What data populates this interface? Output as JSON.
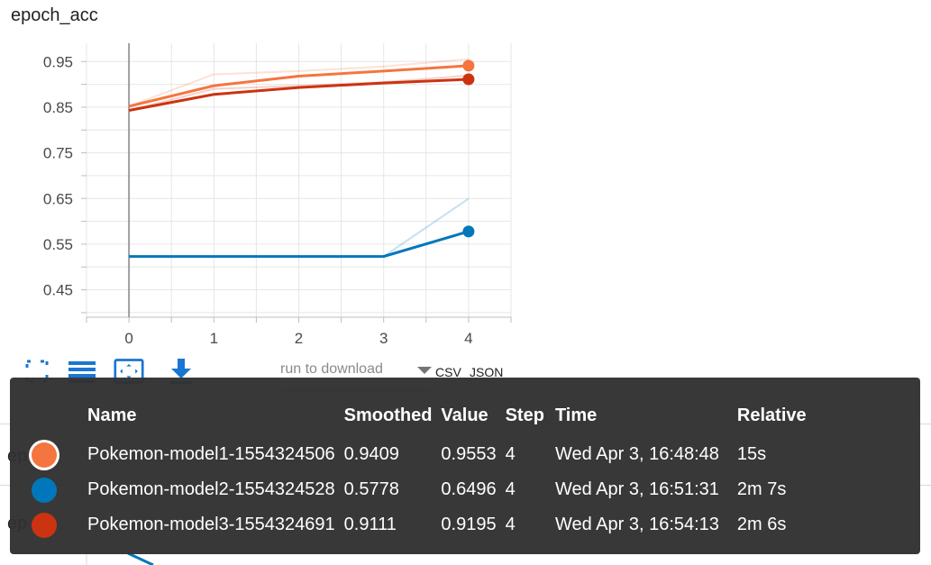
{
  "card": {
    "title": "epoch_acc"
  },
  "chart_data": {
    "type": "line",
    "x": [
      0,
      1,
      2,
      3,
      4
    ],
    "xticks": [
      "0",
      "1",
      "2",
      "3",
      "4"
    ],
    "yticks": [
      "0.45",
      "0.55",
      "0.65",
      "0.75",
      "0.85",
      "0.95"
    ],
    "xlim": [
      -0.5,
      4.5
    ],
    "ylim": [
      0.39,
      0.99
    ],
    "grid": true,
    "series": [
      {
        "name": "Pokemon-model1-1554324506",
        "color": "#f4753f",
        "values": [
          0.852,
          0.922,
          0.929,
          0.939,
          0.9553
        ],
        "smoothed": [
          0.852,
          0.897,
          0.918,
          0.929,
          0.9409
        ]
      },
      {
        "name": "Pokemon-model2-1554324528",
        "color": "#0077bb",
        "values": [
          0.523,
          0.523,
          0.523,
          0.523,
          0.6496
        ],
        "smoothed": [
          0.523,
          0.523,
          0.523,
          0.523,
          0.5778
        ]
      },
      {
        "name": "Pokemon-model3-1554324691",
        "color": "#cc3311",
        "values": [
          0.843,
          0.89,
          0.897,
          0.905,
          0.9195
        ],
        "smoothed": [
          0.843,
          0.878,
          0.893,
          0.903,
          0.9111
        ]
      }
    ]
  },
  "toolbar": {
    "fullscreen_icon": "fullscreen-icon",
    "lines_icon": "toggle-lines-icon",
    "fit_icon": "fit-domain-icon",
    "download_icon": "download-icon",
    "run_placeholder": "run to download",
    "csv_label": "CSV",
    "json_label": "JSON"
  },
  "card2": {
    "title_fragment_a": "ep",
    "title_fragment_b": "ep"
  },
  "tooltip": {
    "headers": [
      "Name",
      "Smoothed",
      "Value",
      "Step",
      "Time",
      "Relative"
    ],
    "rows": [
      {
        "color": "#f4753f",
        "outlined": true,
        "name": "Pokemon-model1-1554324506",
        "smoothed": "0.9409",
        "value": "0.9553",
        "step": "4",
        "time": "Wed Apr 3, 16:48:48",
        "relative": "15s"
      },
      {
        "color": "#0077bb",
        "outlined": false,
        "name": "Pokemon-model2-1554324528",
        "smoothed": "0.5778",
        "value": "0.6496",
        "step": "4",
        "time": "Wed Apr 3, 16:51:31",
        "relative": "2m 7s"
      },
      {
        "color": "#cc3311",
        "outlined": false,
        "name": "Pokemon-model3-1554324691",
        "smoothed": "0.9111",
        "value": "0.9195",
        "step": "4",
        "time": "Wed Apr 3, 16:54:13",
        "relative": "2m 6s"
      }
    ]
  }
}
